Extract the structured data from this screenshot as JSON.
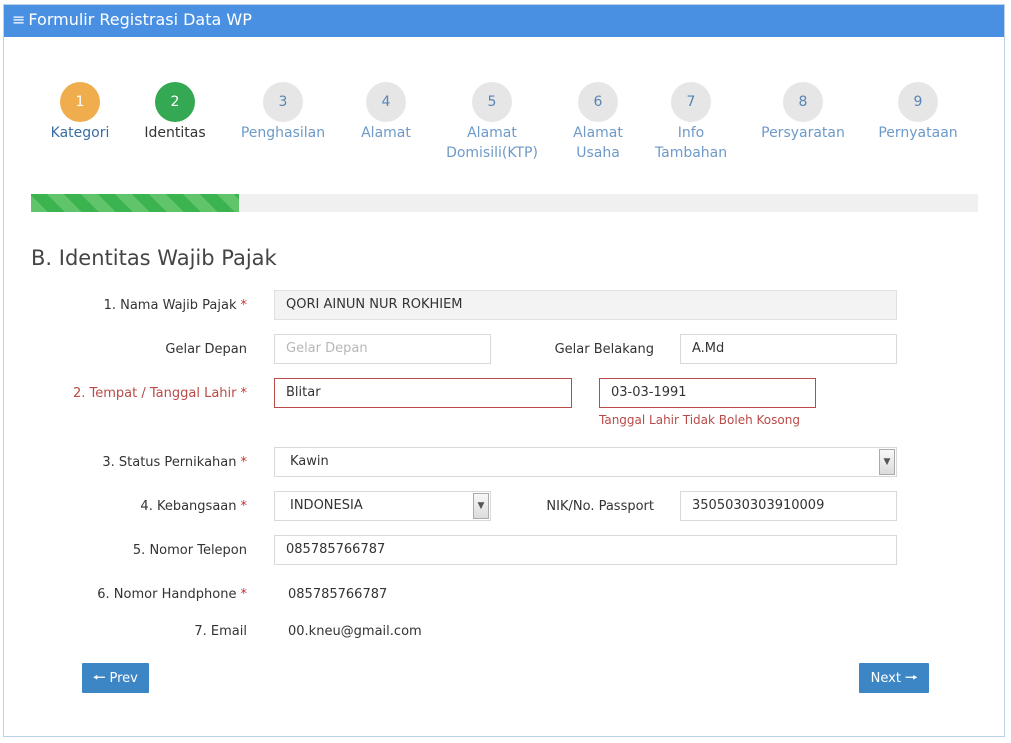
{
  "header": {
    "menu_icon": "≡",
    "title": "Formulir Registrasi Data WP"
  },
  "steps": [
    {
      "number": "1",
      "label": "Kategori"
    },
    {
      "number": "2",
      "label": "Identitas"
    },
    {
      "number": "3",
      "label": "Penghasilan"
    },
    {
      "number": "4",
      "label": "Alamat"
    },
    {
      "number": "5",
      "label": "Alamat Domisili(KTP)"
    },
    {
      "number": "6",
      "label": "Alamat Usaha"
    },
    {
      "number": "7",
      "label": "Info Tambahan"
    },
    {
      "number": "8",
      "label": "Persyaratan"
    },
    {
      "number": "9",
      "label": "Pernyataan"
    }
  ],
  "progress_percent": 22,
  "section_title": "B. Identitas Wajib Pajak",
  "form": {
    "nama": {
      "label": "1. Nama Wajib Pajak",
      "value": "QORI AINUN NUR ROKHIEM"
    },
    "gelar_depan": {
      "label": "Gelar Depan",
      "placeholder": "Gelar Depan",
      "value": ""
    },
    "gelar_belakang": {
      "label": "Gelar Belakang",
      "value": "A.Md"
    },
    "ttl": {
      "label": "2. Tempat / Tanggal Lahir",
      "tempat": "Blitar",
      "tanggal": "03-03-1991",
      "error": "Tanggal Lahir Tidak Boleh Kosong"
    },
    "status": {
      "label": "3. Status Pernikahan",
      "value": "Kawin"
    },
    "kebangsaan": {
      "label": "4. Kebangsaan",
      "value": "INDONESIA"
    },
    "nik": {
      "label": "NIK/No. Passport",
      "value": "3505030303910009"
    },
    "telepon": {
      "label": "5. Nomor Telepon",
      "value": "085785766787"
    },
    "handphone": {
      "label": "6. Nomor Handphone",
      "value": "085785766787"
    },
    "email": {
      "label": "7. Email",
      "value": "00.kneu@gmail.com"
    },
    "required_mark": "*"
  },
  "buttons": {
    "prev": "Prev",
    "next": "Next",
    "prev_icon": "🡐",
    "next_icon": "🡒"
  },
  "colors": {
    "header": "#4a90e2",
    "step1": "#f0ad4e",
    "step2": "#34a853",
    "error": "#b94a48",
    "button": "#3d86c6"
  }
}
